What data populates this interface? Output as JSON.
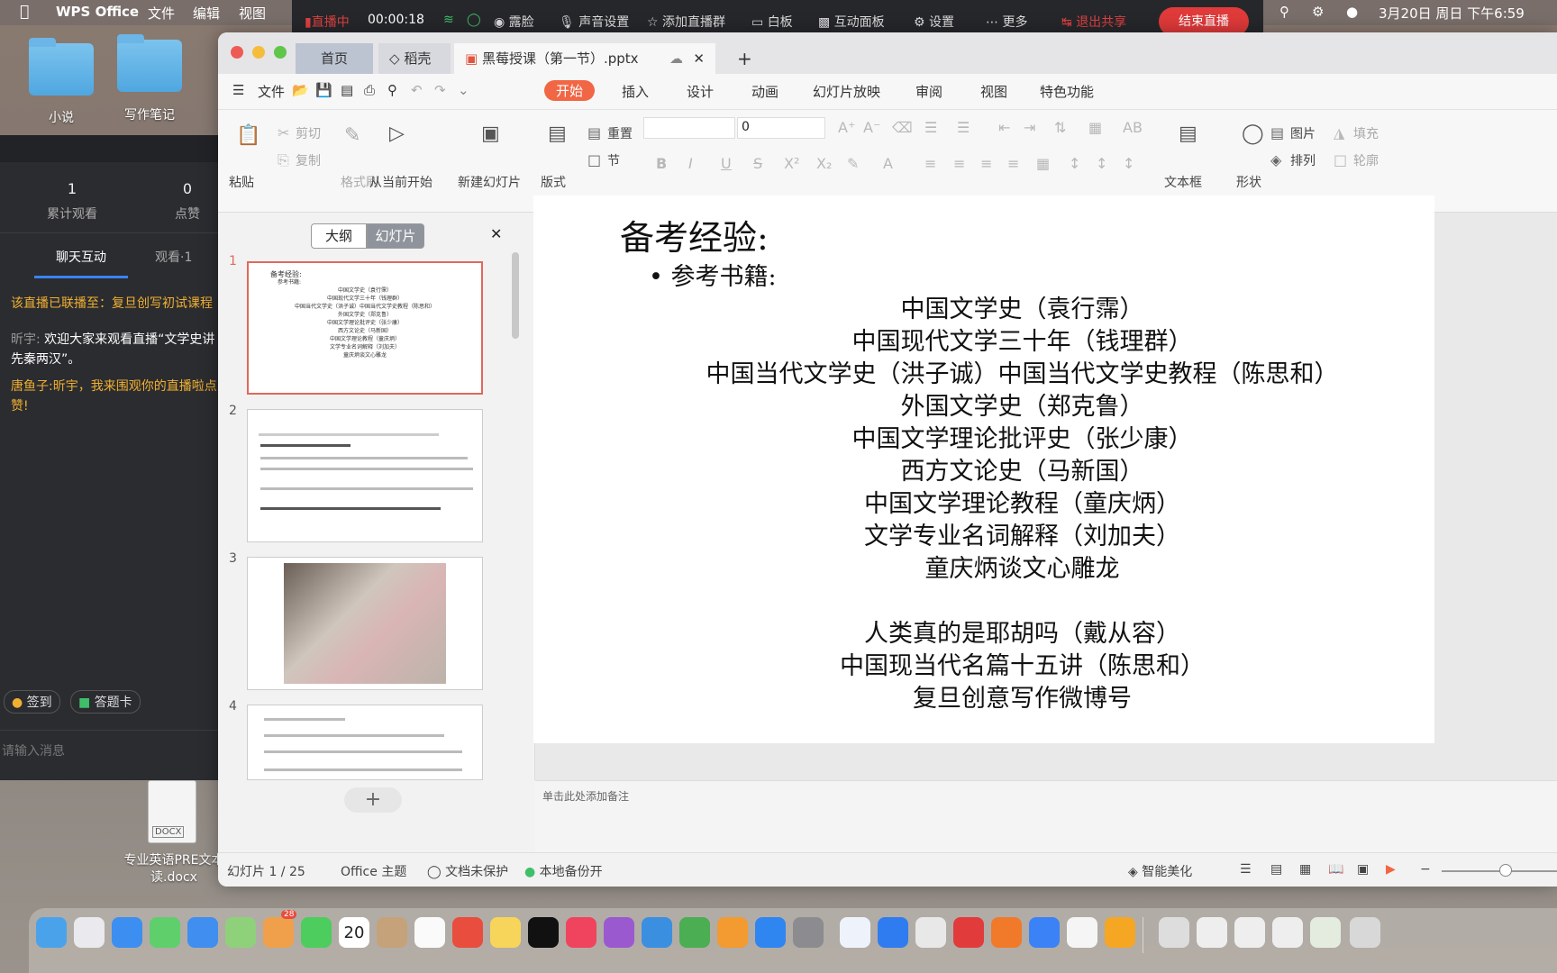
{
  "menubar": {
    "app_name": "WPS Office",
    "menus": [
      "文件",
      "编辑",
      "视图"
    ],
    "datetime": "3月20日 周日 下午6:59"
  },
  "live": {
    "status": "直播中",
    "timer": "00:00:18",
    "items": [
      "露脸",
      "声音设置",
      "添加直播群",
      "白板",
      "互动面板",
      "设置",
      "更多"
    ],
    "exit_share": "退出共享",
    "end_live": "结束直播"
  },
  "desktop": {
    "icons": [
      {
        "label": "小说"
      },
      {
        "label": "写作笔记"
      }
    ],
    "doc": {
      "badge": "DOCX",
      "label": "专业英语PRE文本\n读.docx"
    }
  },
  "livepanel": {
    "stats": [
      {
        "value": "1",
        "caption": "累计观看"
      },
      {
        "value": "0",
        "caption": "点赞"
      }
    ],
    "tabs": [
      "聊天互动",
      "观看·1"
    ],
    "messages": [
      {
        "text": "该直播已联播至：复旦创写初试课程",
        "color": "#f0b030"
      },
      {
        "user": "昕宇:",
        "text": "欢迎大家来观看直播“文学史讲先秦两汉”。",
        "color": "#ffffff"
      },
      {
        "user": "唐鱼子:",
        "text": "昕宇，我来围观你的直播啦点赞!",
        "color": "#f0b030"
      }
    ],
    "buttons": [
      "签到",
      "答题卡"
    ],
    "input_placeholder": "请输入消息"
  },
  "wps": {
    "tabs": [
      "首页",
      "稻壳",
      "黑莓授课（第一节）.pptx"
    ],
    "menu": [
      "文件",
      "开始",
      "插入",
      "设计",
      "动画",
      "幻灯片放映",
      "审阅",
      "视图",
      "特色功能"
    ],
    "ribbon": {
      "paste": "粘贴",
      "cut": "剪切",
      "copy": "复制",
      "format_painter": "格式刷",
      "play_from_current": "从当前开始",
      "new_slide": "新建幻灯片",
      "layout": "版式",
      "reset": "重置",
      "section": "节",
      "font_size": "0",
      "textbox": "文本框",
      "shape": "形状",
      "picture": "图片",
      "arrange": "排列",
      "fill": "填充",
      "outline": "轮廓"
    },
    "pane_tabs": [
      "大纲",
      "幻灯片"
    ],
    "thumbnails": [
      {
        "num": "1"
      },
      {
        "num": "2"
      },
      {
        "num": "3"
      },
      {
        "num": "4"
      }
    ],
    "slide": {
      "title": "备考经验:",
      "bullet": "参考书籍:",
      "books": [
        "中国文学史（袁行霈）",
        "中国现代文学三十年（钱理群）",
        "中国当代文学史（洪子诚）中国当代文学史教程（陈思和）",
        "外国文学史（郑克鲁）",
        "中国文学理论批评史（张少康）",
        "西方文论史（马新国）",
        "中国文学理论教程（童庆炳）",
        "文学专业名词解释（刘加夫）",
        "童庆炳谈文心雕龙",
        "",
        "人类真的是耶胡吗（戴从容）",
        "中国现当代名篇十五讲（陈思和）",
        "复旦创意写作微博号"
      ]
    },
    "notes_placeholder": "单击此处添加备注",
    "status": {
      "slide_counter": "幻灯片 1 / 25",
      "theme": "Office 主题",
      "protection": "文档未保护",
      "backup": "本地备份开",
      "beautify": "智能美化"
    }
  },
  "dock": {
    "calendar_day": "20",
    "badge": "28"
  }
}
